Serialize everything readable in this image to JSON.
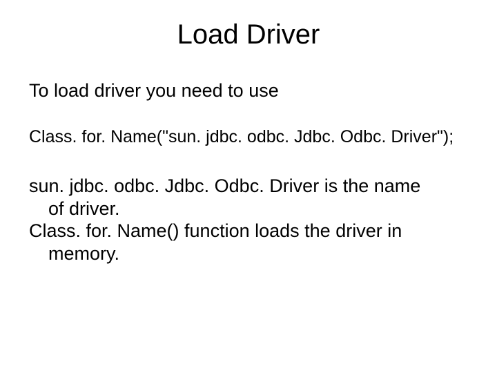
{
  "title": "Load Driver",
  "intro": "To load driver you need to use",
  "code_line": "Class. for. Name(\"sun. jdbc. odbc. Jdbc. Odbc. Driver\");",
  "explain_line1": "sun. jdbc. odbc. Jdbc. Odbc. Driver is the name",
  "explain_line1_cont": "of driver.",
  "explain_line2": "Class. for. Name() function loads the driver in",
  "explain_line2_cont": "memory."
}
